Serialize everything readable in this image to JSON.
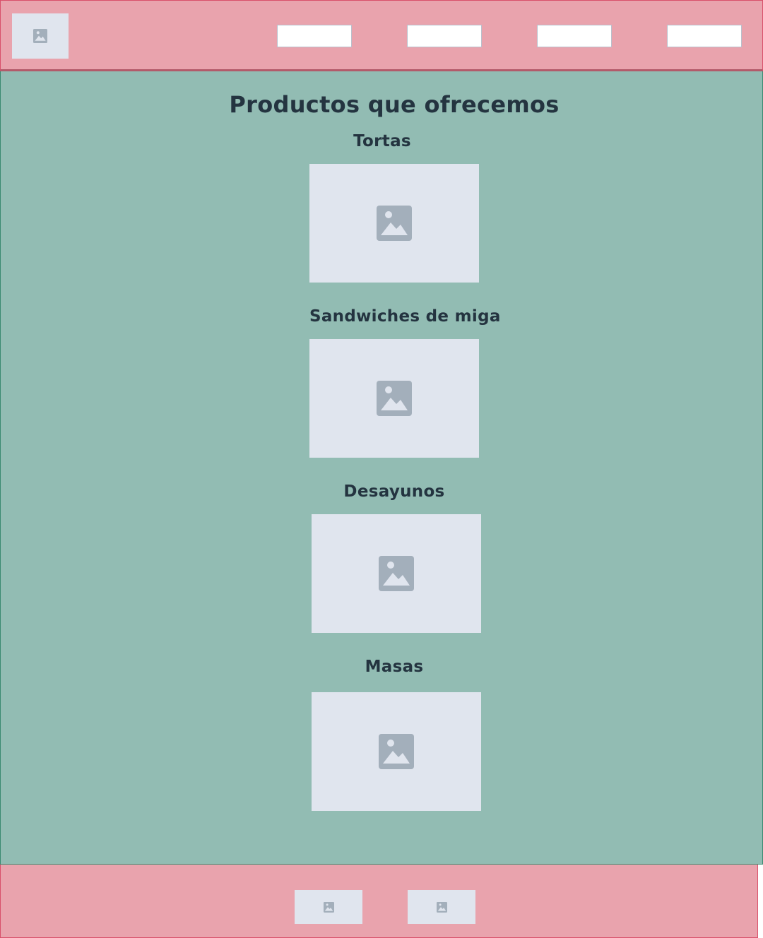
{
  "header": {
    "logo_icon": "image-placeholder-icon",
    "nav_items": [
      "",
      "",
      "",
      ""
    ]
  },
  "main": {
    "title": "Productos que ofrecemos",
    "products": [
      {
        "label": "Tortas",
        "image_icon": "image-placeholder-icon"
      },
      {
        "label": "Sandwiches de miga",
        "image_icon": "image-placeholder-icon"
      },
      {
        "label": "Desayunos",
        "image_icon": "image-placeholder-icon"
      },
      {
        "label": "Masas",
        "image_icon": "image-placeholder-icon"
      }
    ]
  },
  "footer": {
    "icons": [
      "image-placeholder-icon",
      "image-placeholder-icon"
    ]
  },
  "colors": {
    "header_bg": "#e9a3ad",
    "main_bg": "#92bcb3",
    "placeholder_bg": "#e0e5ee",
    "placeholder_icon": "#a3afbb",
    "text": "#243440"
  }
}
